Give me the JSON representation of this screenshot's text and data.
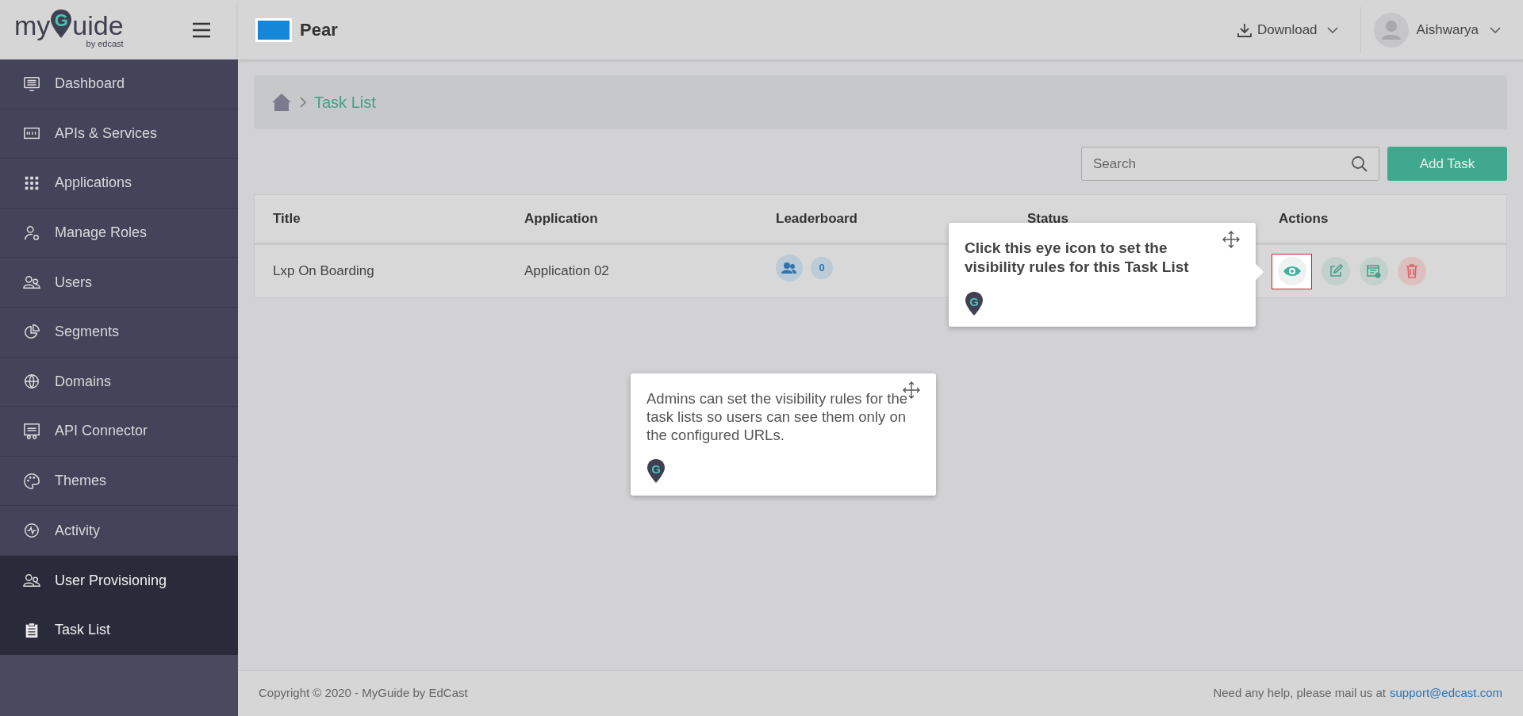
{
  "logo": {
    "prefix": "my",
    "pin_letter": "G",
    "suffix": "uide",
    "byline": "by edcast"
  },
  "sidebar": {
    "items": [
      {
        "label": "Dashboard",
        "selected": false
      },
      {
        "label": "APIs & Services",
        "selected": false
      },
      {
        "label": "Applications",
        "selected": false
      },
      {
        "label": "Manage Roles",
        "selected": false
      },
      {
        "label": "Users",
        "selected": false
      },
      {
        "label": "Segments",
        "selected": false
      },
      {
        "label": "Domains",
        "selected": false
      },
      {
        "label": "API Connector",
        "selected": false
      },
      {
        "label": "Themes",
        "selected": false
      },
      {
        "label": "Activity",
        "selected": false
      },
      {
        "label": "User Provisioning",
        "selected": true
      },
      {
        "label": "Task List",
        "selected": true
      }
    ]
  },
  "header": {
    "org": "Pear",
    "download": "Download",
    "user": "Aishwarya"
  },
  "breadcrumb": [
    "Task List"
  ],
  "search": {
    "placeholder": "Search"
  },
  "add_button": "Add Task",
  "table": {
    "columns": [
      "Title",
      "Application",
      "Leaderboard",
      "Status",
      "Actions"
    ],
    "rows": [
      {
        "title": "Lxp On Boarding",
        "application": "Application 02",
        "leaderboard_count": "0"
      }
    ]
  },
  "tooltips": [
    {
      "text": "Click this eye icon to set the visibility rules for this Task List",
      "pin_letter": "G"
    },
    {
      "text": "Admins can set the visibility rules for the task lists so users can see them only on the configured URLs.",
      "pin_letter": "G"
    }
  ],
  "footer": {
    "copyright": "Copyright © 2020 - MyGuide by EdCast",
    "help": "Need any help, please mail us at",
    "email": "support@edcast.com"
  }
}
